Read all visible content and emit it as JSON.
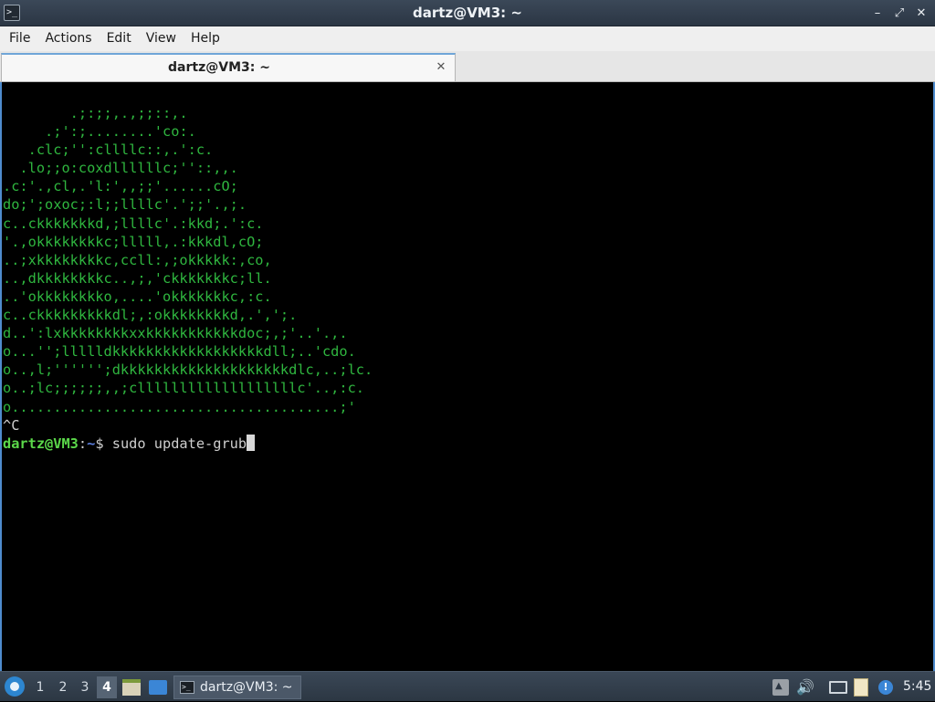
{
  "window": {
    "title": "dartz@VM3: ~"
  },
  "menubar": {
    "items": [
      "File",
      "Actions",
      "Edit",
      "View",
      "Help"
    ]
  },
  "tab": {
    "label": "dartz@VM3: ~"
  },
  "terminal": {
    "ascii_art": "        .;:;;,.,;;::,.\n     .;':;........'co:.\n   .clc;'':cllllc::,.':c.\n  .lo;;o:coxdllllllc;''::,,.\n.c:'.,cl,.'l:',,;;'......cO;\ndo;';oxoc;:l;;llllc'.';;'.,;.\nc..ckkkkkkkd,;llllc'.:kkd;.':c.\n'.,okkkkkkkkc;lllll,.:kkkdl,cO;\n..;xkkkkkkkkc,ccll:,;okkkkk:,co,\n..,dkkkkkkkkc..,;,'ckkkkkkkc;ll.\n..'okkkkkkkko,....'okkkkkkkc,:c.\nc..ckkkkkkkkkdl;,:okkkkkkkkd,.',';.\nd..':lxkkkkkkkkxxkkkkkkkkkkkdoc;,;'..'.,.\no...'';llllldkkkkkkkkkkkkkkkkkkdll;..'cdo.\no..,l;'''''';dkkkkkkkkkkkkkkkkkkkkdlc,..;lc.\no..;lc;;;;;;,,;clllllllllllllllllllc'..,:c.\no.......................................;'",
    "interrupt": "^C",
    "prompt_user": "dartz@VM3",
    "prompt_sep": ":",
    "prompt_path": "~",
    "prompt_symbol": "$ ",
    "command": "sudo update-grub"
  },
  "taskbar": {
    "workspaces": [
      "1",
      "2",
      "3",
      "4"
    ],
    "active_workspace": "4",
    "task_label": "dartz@VM3: ~",
    "clock": "5:45"
  }
}
